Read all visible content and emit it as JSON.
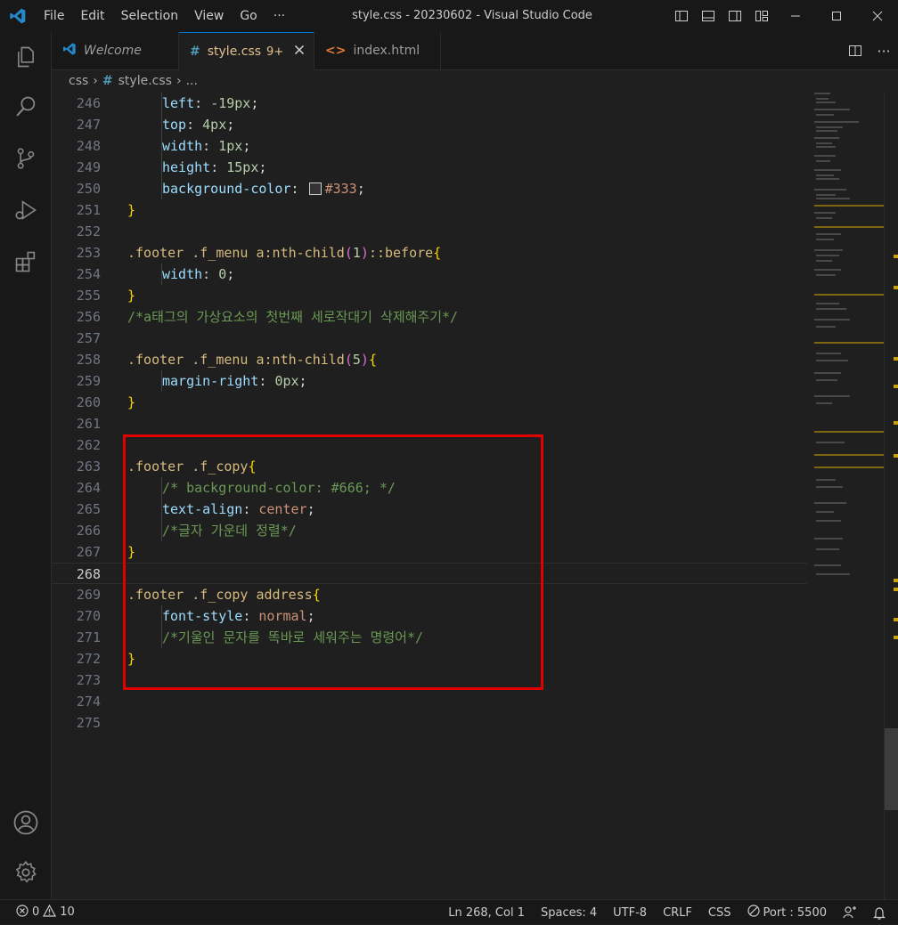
{
  "window": {
    "title": "style.css - 20230602 - Visual Studio Code"
  },
  "menu": [
    "File",
    "Edit",
    "Selection",
    "View",
    "Go",
    "···"
  ],
  "tabs": [
    {
      "label": "Welcome",
      "icon": "vscode-logo-icon"
    },
    {
      "label": "style.css",
      "badge": "9+",
      "icon": "hash-icon",
      "active": true
    },
    {
      "label": "index.html",
      "icon": "html-brackets-icon"
    }
  ],
  "breadcrumb": {
    "folder": "css",
    "file": "style.css",
    "more": "..."
  },
  "editor": {
    "line_numbers": [
      "246",
      "247",
      "248",
      "249",
      "250",
      "251",
      "252",
      "253",
      "254",
      "255",
      "256",
      "257",
      "258",
      "259",
      "260",
      "261",
      "262",
      "263",
      "264",
      "265",
      "266",
      "267",
      "268",
      "269",
      "270",
      "271",
      "272",
      "273",
      "274",
      "275"
    ],
    "active_line": "268",
    "text": {
      "l246_prop": "left",
      "l246_val": "-19px",
      "l247_prop": "top",
      "l247_val": "4px",
      "l248_prop": "width",
      "l248_val": "1px",
      "l249_prop": "height",
      "l249_val": "15px",
      "l250_prop": "background-color",
      "l250_val": "#333",
      "l253_sel": ".footer .f_menu a:nth-child",
      "l253_arg": "1",
      "l253_pseudo": "::before",
      "l254_prop": "width",
      "l254_val": "0",
      "l256_cmt": "/*a태그의 가상요소의 첫번째 세로작대기 삭제해주기*/",
      "l258_sel": ".footer .f_menu a:nth-child",
      "l258_arg": "5",
      "l259_prop": "margin-right",
      "l259_val": "0px",
      "l263_sel": ".footer .f_copy",
      "l264_cmt": "/* background-color: #666; */",
      "l265_prop": "text-align",
      "l265_val": "center",
      "l266_cmt": "/*글자 가운데 정렬*/",
      "l269_sel": ".footer .f_copy address",
      "l270_prop": "font-style",
      "l270_val": "normal",
      "l271_cmt": "/*기울인 문자를 똑바로 세워주는 명령어*/"
    }
  },
  "statusbar": {
    "errors": "0",
    "warnings": "10",
    "position": "Ln 268, Col 1",
    "spaces": "Spaces: 4",
    "encoding": "UTF-8",
    "eol": "CRLF",
    "language": "CSS",
    "port": "Port : 5500"
  },
  "colors": {
    "accent": "#0078d4",
    "highlight_box": "#e00000",
    "selector": "#d7ba7d",
    "property": "#9cdcfe",
    "number": "#b5cea8",
    "value": "#ce9178",
    "comment": "#6a9955",
    "bracket": "#ffd700"
  }
}
